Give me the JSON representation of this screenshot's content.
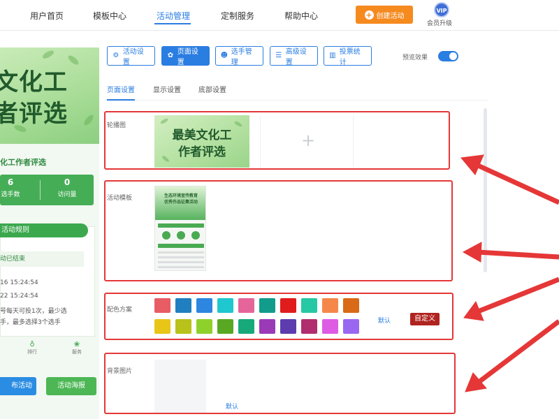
{
  "topnav": {
    "items": [
      "用户首页",
      "模板中心",
      "活动管理",
      "定制服务",
      "帮助中心"
    ],
    "create_label": "创建活动",
    "vip_badge": "VIP",
    "vip_label": "会员升级"
  },
  "preview": {
    "banner_line1": "文化工",
    "banner_line2": "者评选",
    "title": "化工作者评选",
    "stats": [
      {
        "value": "6",
        "label": "选手数"
      },
      {
        "value": "0",
        "label": "访问量"
      }
    ],
    "rules_tab": "活动规则",
    "status": "动已结束",
    "rule_lines": [
      "16 15:24:54",
      "22 15:24:54",
      "号每天可投1次，最少选",
      "手，最多选择3个选手"
    ],
    "icons": [
      {
        "name": "rank-icon",
        "label": "排行"
      },
      {
        "name": "service-icon",
        "label": "服务"
      }
    ],
    "publish_label": "布活动",
    "poster_label": "活动海报"
  },
  "tabs": [
    {
      "label": "活动设置",
      "icon": "settings-icon"
    },
    {
      "label": "页面设置",
      "icon": "gear-icon"
    },
    {
      "label": "选手管理",
      "icon": "users-icon"
    },
    {
      "label": "高级设置",
      "icon": "advanced-icon"
    },
    {
      "label": "投票统计",
      "icon": "chart-icon"
    }
  ],
  "preview_toggle_label": "预览效果",
  "preview_toggle_on": true,
  "subtabs": [
    "页面设置",
    "显示设置",
    "底部设置"
  ],
  "sections": {
    "carousel_label": "轮播图",
    "carousel_image_line1": "最美文化工",
    "carousel_image_line2": "作者评选",
    "template_label": "活动模板",
    "template_title_line1": "生态环境宣传教育",
    "template_title_line2": "优秀作品征集活动",
    "color_label": "配色方案",
    "color_default": "默认",
    "color_custom": "自定义",
    "bg_label": "背景图片",
    "bg_default": "默认"
  },
  "colors": {
    "accent": "#2a7de1",
    "highlight_red": "#e53737",
    "swatches_row1": [
      "#e85c63",
      "#1f7fc0",
      "#2d86e0",
      "#1fc7cf",
      "#e5659a",
      "#119c8b",
      "#e01c1c",
      "#26c9a3",
      "#f6874a",
      "#d96a17"
    ],
    "swatches_row2": [
      "#e8c618",
      "#b8c21a",
      "#8fd12b",
      "#59a823",
      "#18a97a",
      "#9a3ab7",
      "#5c3cae",
      "#b02e6f",
      "#de5be4",
      "#9a68f0"
    ]
  }
}
